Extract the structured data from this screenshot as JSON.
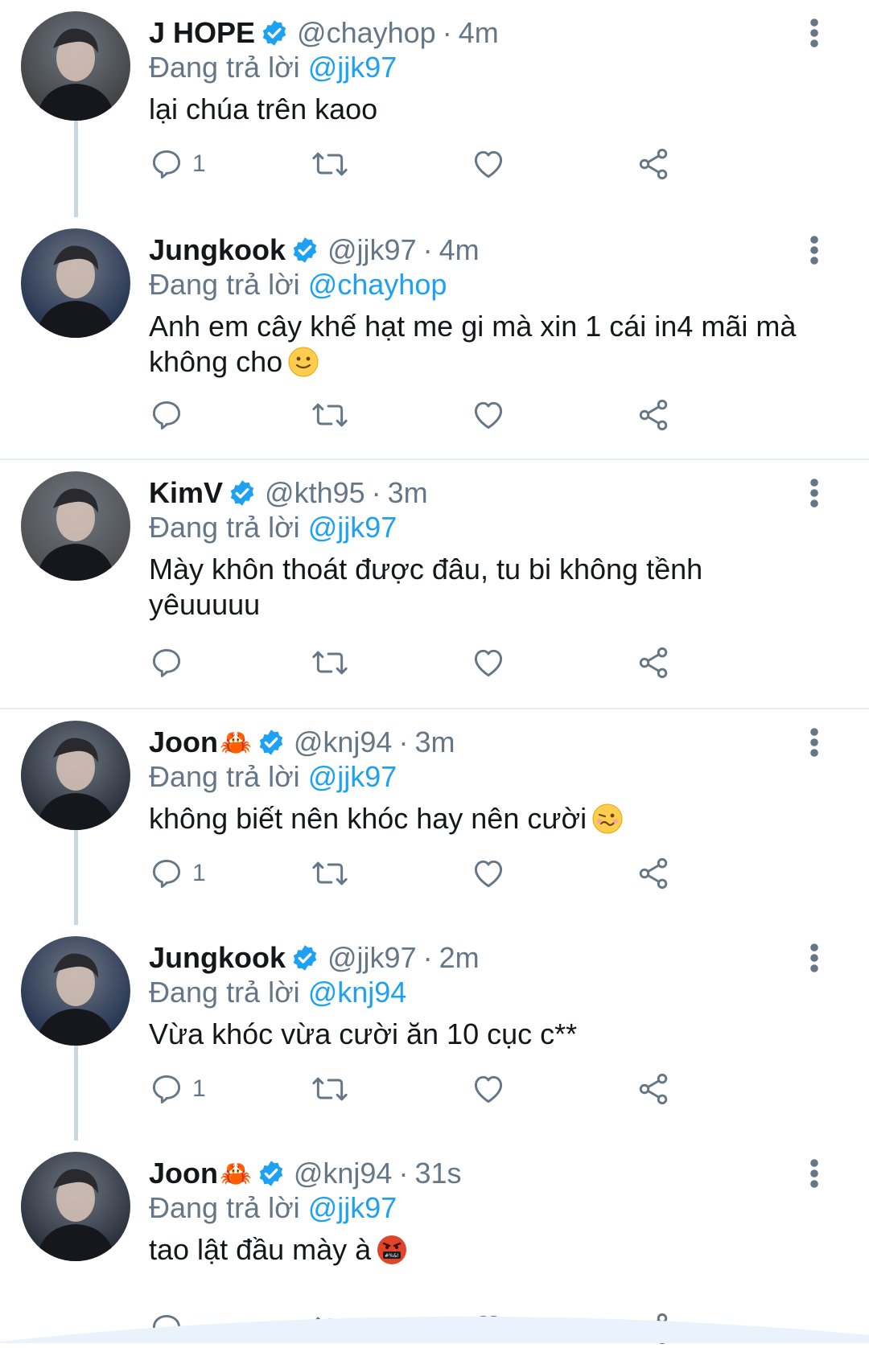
{
  "tweets": [
    {
      "name": "J HOPE",
      "name_suffix_emoji": "",
      "handle": "@chayhop",
      "time": "4m",
      "reply_prefix": "Đang trả lời",
      "reply_to": "@jjk97",
      "text": "lại chúa trên kaoo",
      "text_emoji": "",
      "reply_count": "1",
      "avatar_tone": "#3a3a3a"
    },
    {
      "name": "Jungkook",
      "name_suffix_emoji": "",
      "handle": "@jjk97",
      "time": "4m",
      "reply_prefix": "Đang trả lời",
      "reply_to": "@chayhop",
      "text": "Anh em cây khế hạt me gi mà xin 1 cái in4 mãi mà không cho",
      "text_emoji": "slightly-smiling",
      "reply_count": "",
      "avatar_tone": "#1a2a4a"
    },
    {
      "name": "KimV",
      "name_suffix_emoji": "",
      "handle": "@kth95",
      "time": "3m",
      "reply_prefix": "Đang trả lời",
      "reply_to": "@jjk97",
      "text": "Mày khôn thoát được đâu, tu bi không tềnh yêuuuuu",
      "text_emoji": "",
      "reply_count": "",
      "avatar_tone": "#4a4a4a"
    },
    {
      "name": "Joon",
      "name_suffix_emoji": "🦀",
      "handle": "@knj94",
      "time": "3m",
      "reply_prefix": "Đang trả lời",
      "reply_to": "@jjk97",
      "text": "không biết nên khóc hay nên cười",
      "text_emoji": "woozy",
      "reply_count": "1",
      "avatar_tone": "#1f2630"
    },
    {
      "name": "Jungkook",
      "name_suffix_emoji": "",
      "handle": "@jjk97",
      "time": "2m",
      "reply_prefix": "Đang trả lời",
      "reply_to": "@knj94",
      "text": "Vừa khóc vừa cười ăn 10 cục c**",
      "text_emoji": "",
      "reply_count": "1",
      "avatar_tone": "#1a2a4a"
    },
    {
      "name": "Joon",
      "name_suffix_emoji": "🦀",
      "handle": "@knj94",
      "time": "31s",
      "reply_prefix": "Đang trả lời",
      "reply_to": "@jjk97",
      "text": "tao lật đầu mày à",
      "text_emoji": "cursing",
      "reply_count": "",
      "avatar_tone": "#1f2630"
    }
  ],
  "colors": {
    "verified": "#1da1f2",
    "mention": "#1da1f2",
    "secondary_text": "#657786",
    "icon": "#657786",
    "divider": "#e6ecf0",
    "thread_line": "#ccd6dd"
  },
  "icons": {
    "reply": "reply-icon",
    "retweet": "retweet-icon",
    "like": "heart-icon",
    "share": "share-icon",
    "more": "more-vertical-icon",
    "verified": "verified-badge-icon"
  }
}
